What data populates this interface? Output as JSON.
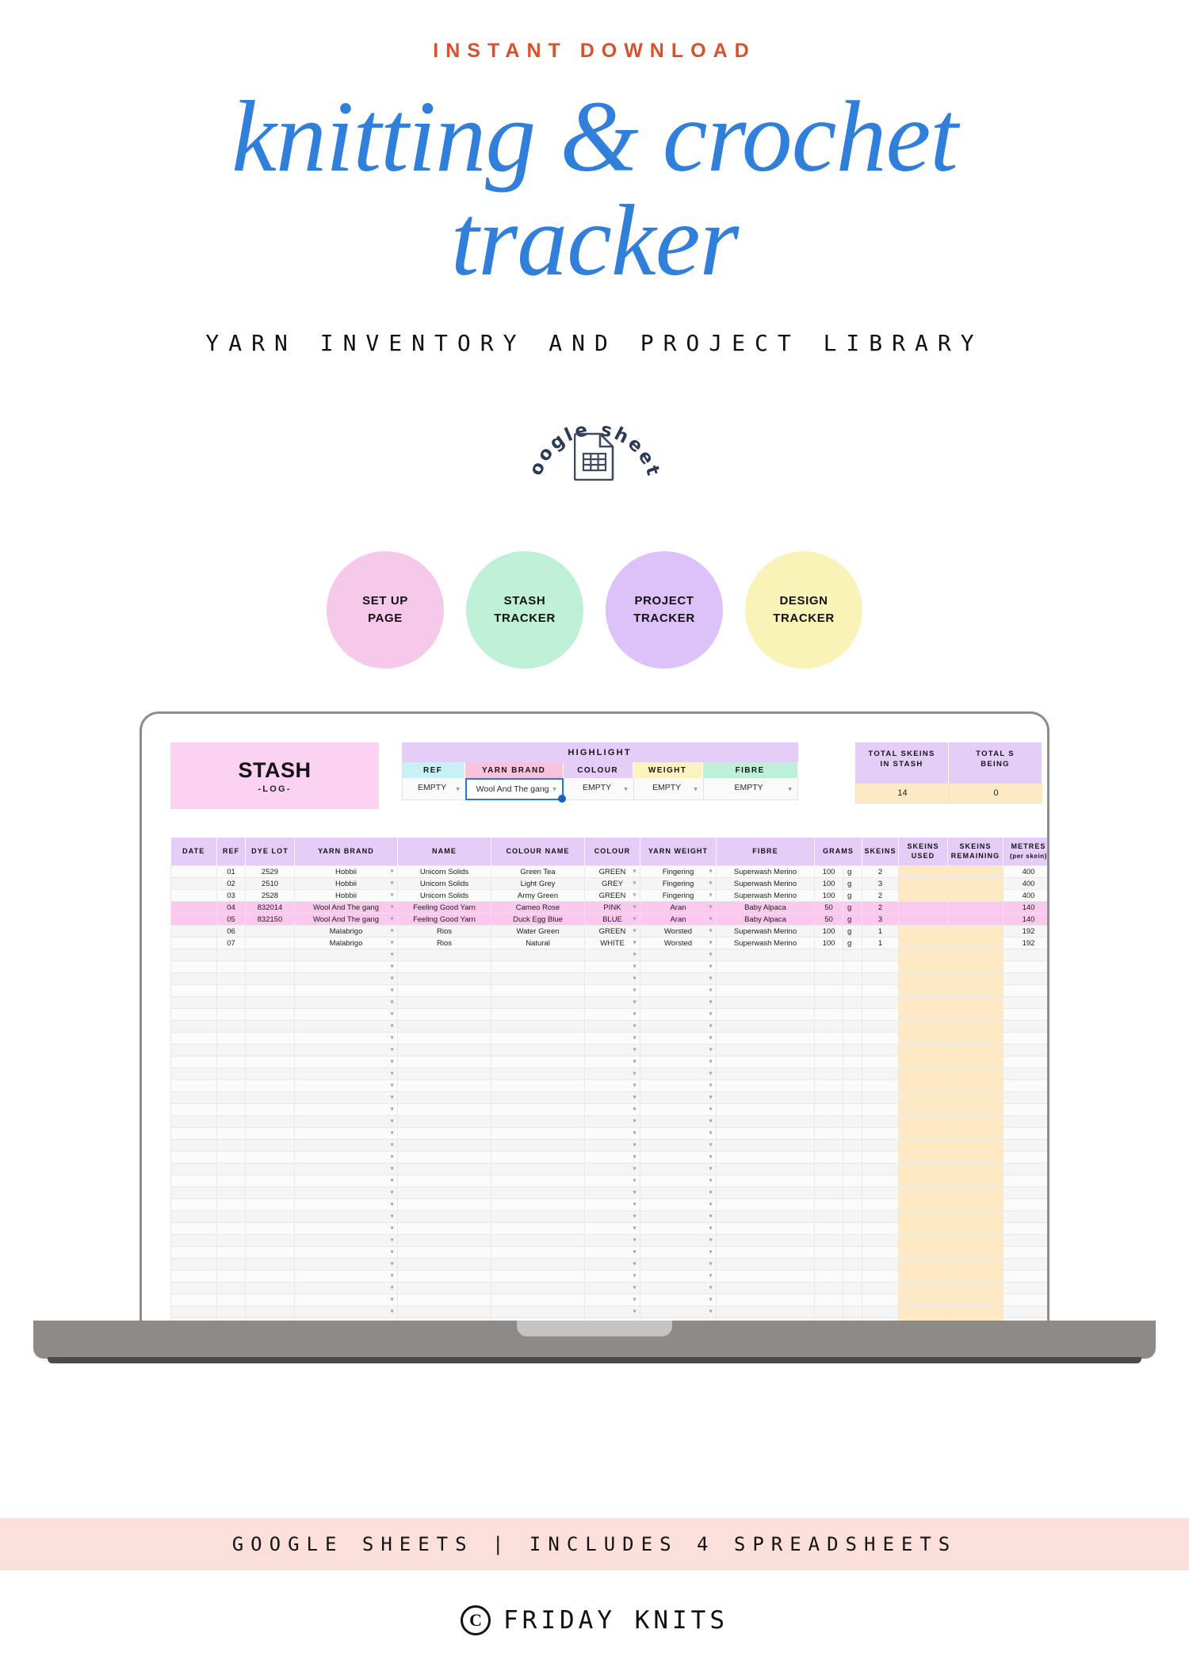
{
  "header": {
    "eyebrow": "INSTANT DOWNLOAD",
    "title_line1": "knitting & crochet",
    "title_line2": "tracker",
    "subtitle": "YARN INVENTORY AND PROJECT LIBRARY",
    "title_color": "#2f7fdb",
    "eyebrow_color": "#d9512c"
  },
  "badge": {
    "text_top": "google",
    "text_bottom": "sheets",
    "full_text": "google sheets",
    "icon": "spreadsheet-document-icon"
  },
  "circles": [
    {
      "line1": "SET UP",
      "line2": "PAGE",
      "color": "#f6c9ea"
    },
    {
      "line1": "STASH",
      "line2": "TRACKER",
      "color": "#bdf0d6"
    },
    {
      "line1": "PROJECT",
      "line2": "TRACKER",
      "color": "#ddc2fa"
    },
    {
      "line1": "DESIGN",
      "line2": "TRACKER",
      "color": "#faf3b8"
    }
  ],
  "sheet": {
    "stash_title": "STASH",
    "stash_sub": "-LOG-",
    "highlight_label": "HIGHLIGHT",
    "highlight_filters": [
      {
        "header": "REF",
        "value": "EMPTY",
        "header_color": "#c8f0f5",
        "selected": false
      },
      {
        "header": "YARN BRAND",
        "value": "Wool And The gang",
        "header_color": "#fbc2dd",
        "selected": true
      },
      {
        "header": "COLOUR",
        "value": "EMPTY",
        "header_color": "#e4cdf7",
        "selected": false
      },
      {
        "header": "WEIGHT",
        "value": "EMPTY",
        "header_color": "#fbf4bf",
        "selected": false
      },
      {
        "header": "FIBRE",
        "value": "EMPTY",
        "header_color": "#bdf0d6",
        "selected": false
      }
    ],
    "totals": [
      {
        "label_line1": "TOTAL SKEINS",
        "label_line2": "IN STASH",
        "value": "14"
      },
      {
        "label_line1": "TOTAL S",
        "label_line2": "BEING",
        "value": "0"
      }
    ],
    "columns": [
      {
        "label": "DATE",
        "sub": ""
      },
      {
        "label": "REF",
        "sub": ""
      },
      {
        "label": "DYE LOT",
        "sub": ""
      },
      {
        "label": "YARN BRAND",
        "sub": ""
      },
      {
        "label": "NAME",
        "sub": ""
      },
      {
        "label": "COLOUR NAME",
        "sub": ""
      },
      {
        "label": "COLOUR",
        "sub": ""
      },
      {
        "label": "YARN WEIGHT",
        "sub": ""
      },
      {
        "label": "FIBRE",
        "sub": ""
      },
      {
        "label": "GRAMS",
        "sub": ""
      },
      {
        "label": "SKEINS",
        "sub": ""
      },
      {
        "label": "SKEINS USED",
        "sub": ""
      },
      {
        "label": "SKEINS REMAINING",
        "sub": ""
      },
      {
        "label": "METRES",
        "sub": "(per skein)"
      }
    ],
    "rows": [
      {
        "date": "",
        "ref": "01",
        "dye_lot": "2529",
        "brand": "Hobbii",
        "name": "Unicorn Solids",
        "colour_name": "Green Tea",
        "colour": "GREEN",
        "weight": "Fingering",
        "fibre": "Superwash Merino",
        "grams": "100",
        "unit": "g",
        "skeins": "2",
        "used": "",
        "remaining": "",
        "metres": "400",
        "highlighted": false
      },
      {
        "date": "",
        "ref": "02",
        "dye_lot": "2510",
        "brand": "Hobbii",
        "name": "Unicorn Solids",
        "colour_name": "Light Grey",
        "colour": "GREY",
        "weight": "Fingering",
        "fibre": "Superwash Merino",
        "grams": "100",
        "unit": "g",
        "skeins": "3",
        "used": "",
        "remaining": "",
        "metres": "400",
        "highlighted": false
      },
      {
        "date": "",
        "ref": "03",
        "dye_lot": "2528",
        "brand": "Hobbii",
        "name": "Unicorn Solids",
        "colour_name": "Army Green",
        "colour": "GREEN",
        "weight": "Fingering",
        "fibre": "Superwash Merino",
        "grams": "100",
        "unit": "g",
        "skeins": "2",
        "used": "",
        "remaining": "",
        "metres": "400",
        "highlighted": false
      },
      {
        "date": "",
        "ref": "04",
        "dye_lot": "832014",
        "brand": "Wool And The gang",
        "name": "Feeling Good Yarn",
        "colour_name": "Cameo Rose",
        "colour": "PINK",
        "weight": "Aran",
        "fibre": "Baby Alpaca",
        "grams": "50",
        "unit": "g",
        "skeins": "2",
        "used": "",
        "remaining": "",
        "metres": "140",
        "highlighted": true
      },
      {
        "date": "",
        "ref": "05",
        "dye_lot": "832150",
        "brand": "Wool And The gang",
        "name": "Feeling Good Yarn",
        "colour_name": "Duck Egg Blue",
        "colour": "BLUE",
        "weight": "Aran",
        "fibre": "Baby Alpaca",
        "grams": "50",
        "unit": "g",
        "skeins": "3",
        "used": "",
        "remaining": "",
        "metres": "140",
        "highlighted": true
      },
      {
        "date": "",
        "ref": "06",
        "dye_lot": "",
        "brand": "Malabrigo",
        "name": "Rios",
        "colour_name": "Water Green",
        "colour": "GREEN",
        "weight": "Worsted",
        "fibre": "Superwash Merino",
        "grams": "100",
        "unit": "g",
        "skeins": "1",
        "used": "",
        "remaining": "",
        "metres": "192",
        "highlighted": false
      },
      {
        "date": "",
        "ref": "07",
        "dye_lot": "",
        "brand": "Malabrigo",
        "name": "Rios",
        "colour_name": "Natural",
        "colour": "WHITE",
        "weight": "Worsted",
        "fibre": "Superwash Merino",
        "grams": "100",
        "unit": "g",
        "skeins": "1",
        "used": "",
        "remaining": "",
        "metres": "192",
        "highlighted": false
      }
    ],
    "empty_row_count": 38
  },
  "footer": {
    "band_text": "GOOGLE SHEETS | INCLUDES 4 SPREADSHEETS",
    "band_color": "#fadfda",
    "copyright_symbol": "C",
    "brand_name": "FRIDAY KNITS"
  }
}
